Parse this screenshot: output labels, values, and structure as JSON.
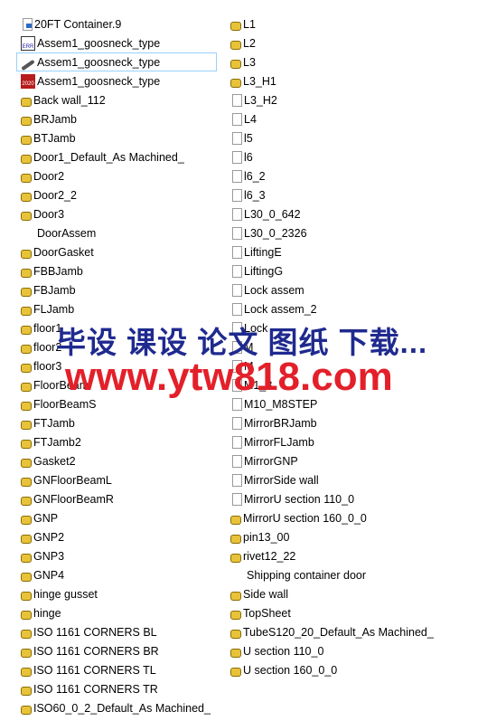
{
  "left": [
    {
      "name": "20FT Container.9",
      "icon": "document-icon"
    },
    {
      "name": "Assem1_goosneck_type",
      "icon": "err-file-icon"
    },
    {
      "name": "Assem1_goosneck_type",
      "icon": "edrawing-icon",
      "selected": true
    },
    {
      "name": "Assem1_goosneck_type",
      "icon": "solidworks-2020-icon"
    },
    {
      "name": "Back wall_112",
      "icon": "part-icon"
    },
    {
      "name": "BRJamb",
      "icon": "part-icon"
    },
    {
      "name": "BTJamb",
      "icon": "part-icon"
    },
    {
      "name": "Door1_Default_As Machined_",
      "icon": "part-icon"
    },
    {
      "name": "Door2",
      "icon": "part-icon"
    },
    {
      "name": "Door2_2",
      "icon": "part-icon"
    },
    {
      "name": "Door3",
      "icon": "part-icon"
    },
    {
      "name": "DoorAssem",
      "icon": "none"
    },
    {
      "name": "DoorGasket",
      "icon": "part-icon"
    },
    {
      "name": "FBBJamb",
      "icon": "part-icon"
    },
    {
      "name": "FBJamb",
      "icon": "part-icon"
    },
    {
      "name": "FLJamb",
      "icon": "part-icon"
    },
    {
      "name": "floor1",
      "icon": "part-icon"
    },
    {
      "name": "floor2",
      "icon": "part-icon"
    },
    {
      "name": "floor3",
      "icon": "part-icon"
    },
    {
      "name": "FloorBeam",
      "icon": "part-icon"
    },
    {
      "name": "FloorBeamS",
      "icon": "part-icon"
    },
    {
      "name": "FTJamb",
      "icon": "part-icon"
    },
    {
      "name": "FTJamb2",
      "icon": "part-icon"
    },
    {
      "name": "Gasket2",
      "icon": "part-icon"
    },
    {
      "name": "GNFloorBeamL",
      "icon": "part-icon"
    },
    {
      "name": "GNFloorBeamR",
      "icon": "part-icon"
    },
    {
      "name": "GNP",
      "icon": "part-icon"
    },
    {
      "name": "GNP2",
      "icon": "part-icon"
    },
    {
      "name": "GNP3",
      "icon": "part-icon"
    },
    {
      "name": "GNP4",
      "icon": "part-icon"
    },
    {
      "name": "hinge gusset",
      "icon": "part-icon"
    },
    {
      "name": "hinge",
      "icon": "part-icon"
    },
    {
      "name": "ISO 1161 CORNERS BL",
      "icon": "part-icon"
    },
    {
      "name": "ISO 1161 CORNERS BR",
      "icon": "part-icon"
    },
    {
      "name": "ISO 1161 CORNERS TL",
      "icon": "part-icon"
    },
    {
      "name": "ISO 1161 CORNERS TR",
      "icon": "part-icon"
    },
    {
      "name": "ISO60_0_2_Default_As Machined_",
      "icon": "part-icon"
    }
  ],
  "right": [
    {
      "name": "L1",
      "icon": "part-icon"
    },
    {
      "name": "L2",
      "icon": "part-icon"
    },
    {
      "name": "L3",
      "icon": "part-icon"
    },
    {
      "name": "L3_H1",
      "icon": "part-icon"
    },
    {
      "name": "L3_H2",
      "icon": "document-icon"
    },
    {
      "name": "L4",
      "icon": "document-icon"
    },
    {
      "name": "l5",
      "icon": "document-icon"
    },
    {
      "name": "l6",
      "icon": "document-icon"
    },
    {
      "name": "l6_2",
      "icon": "document-icon"
    },
    {
      "name": "l6_3",
      "icon": "document-icon"
    },
    {
      "name": "L30_0_642",
      "icon": "document-icon"
    },
    {
      "name": "L30_0_2326",
      "icon": "document-icon"
    },
    {
      "name": "LiftingE",
      "icon": "document-icon"
    },
    {
      "name": "LiftingG",
      "icon": "document-icon"
    },
    {
      "name": "Lock assem",
      "icon": "document-icon"
    },
    {
      "name": "Lock assem_2",
      "icon": "document-icon"
    },
    {
      "name": "Lock",
      "icon": "document-icon"
    },
    {
      "name": "M",
      "icon": "document-icon"
    },
    {
      "name": "M",
      "icon": "document-icon"
    },
    {
      "name": "M1_8",
      "icon": "document-icon"
    },
    {
      "name": "M10_M8STEP",
      "icon": "document-icon"
    },
    {
      "name": "MirrorBRJamb",
      "icon": "document-icon"
    },
    {
      "name": "MirrorFLJamb",
      "icon": "document-icon"
    },
    {
      "name": "MirrorGNP",
      "icon": "document-icon"
    },
    {
      "name": "MirrorSide wall",
      "icon": "document-icon"
    },
    {
      "name": "MirrorU section 110_0",
      "icon": "document-icon"
    },
    {
      "name": "MirrorU section 160_0_0",
      "icon": "part-icon"
    },
    {
      "name": "pin13_00",
      "icon": "part-icon"
    },
    {
      "name": "rivet12_22",
      "icon": "part-icon"
    },
    {
      "name": "Shipping container door",
      "icon": "none"
    },
    {
      "name": "Side wall",
      "icon": "part-icon"
    },
    {
      "name": "TopSheet",
      "icon": "part-icon"
    },
    {
      "name": "TubeS120_20_Default_As Machined_",
      "icon": "part-icon"
    },
    {
      "name": "U section 110_0",
      "icon": "part-icon"
    },
    {
      "name": "U section 160_0_0",
      "icon": "part-icon"
    }
  ],
  "watermark": {
    "line1": "毕设 课设 论文 图纸 下载...",
    "line2": "www.ytw818.com"
  }
}
